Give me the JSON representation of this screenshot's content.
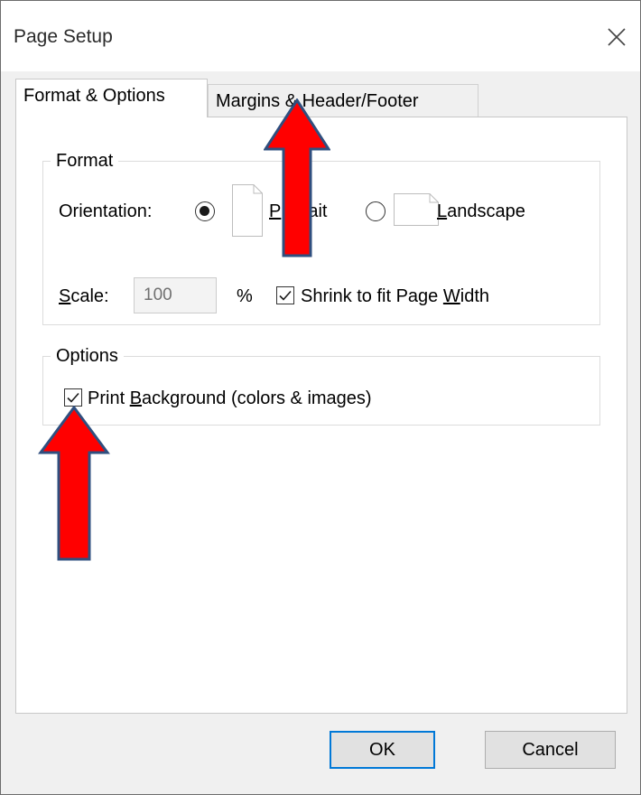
{
  "window": {
    "title": "Page Setup",
    "close_glyph": "close-icon"
  },
  "tabs": [
    {
      "label": "Format & Options",
      "active": true
    },
    {
      "label": "Margins & Header/Footer",
      "active": false
    }
  ],
  "format_group": {
    "legend": "Format",
    "orientation_label": "Orientation:",
    "portrait": {
      "prefix": "P",
      "suffix": "ait",
      "selected": true
    },
    "landscape": {
      "underline": "L",
      "rest": "andscape",
      "selected": false
    },
    "scale_label_u": "S",
    "scale_label_rest": "cale:",
    "scale_value": "100",
    "percent_sign": "%",
    "shrink": {
      "before": "Shrink to fit Page ",
      "underline": "W",
      "after": "idth",
      "checked": true
    }
  },
  "options_group": {
    "legend": "Options",
    "print_bg": {
      "before": "Print ",
      "underline": "B",
      "after": "ackground (colors & images)",
      "checked": true
    }
  },
  "buttons": {
    "ok": "OK",
    "cancel": "Cancel"
  },
  "annotations": {
    "arrow_color": "#ff0000",
    "arrow_outline": "#2f4f7f"
  }
}
